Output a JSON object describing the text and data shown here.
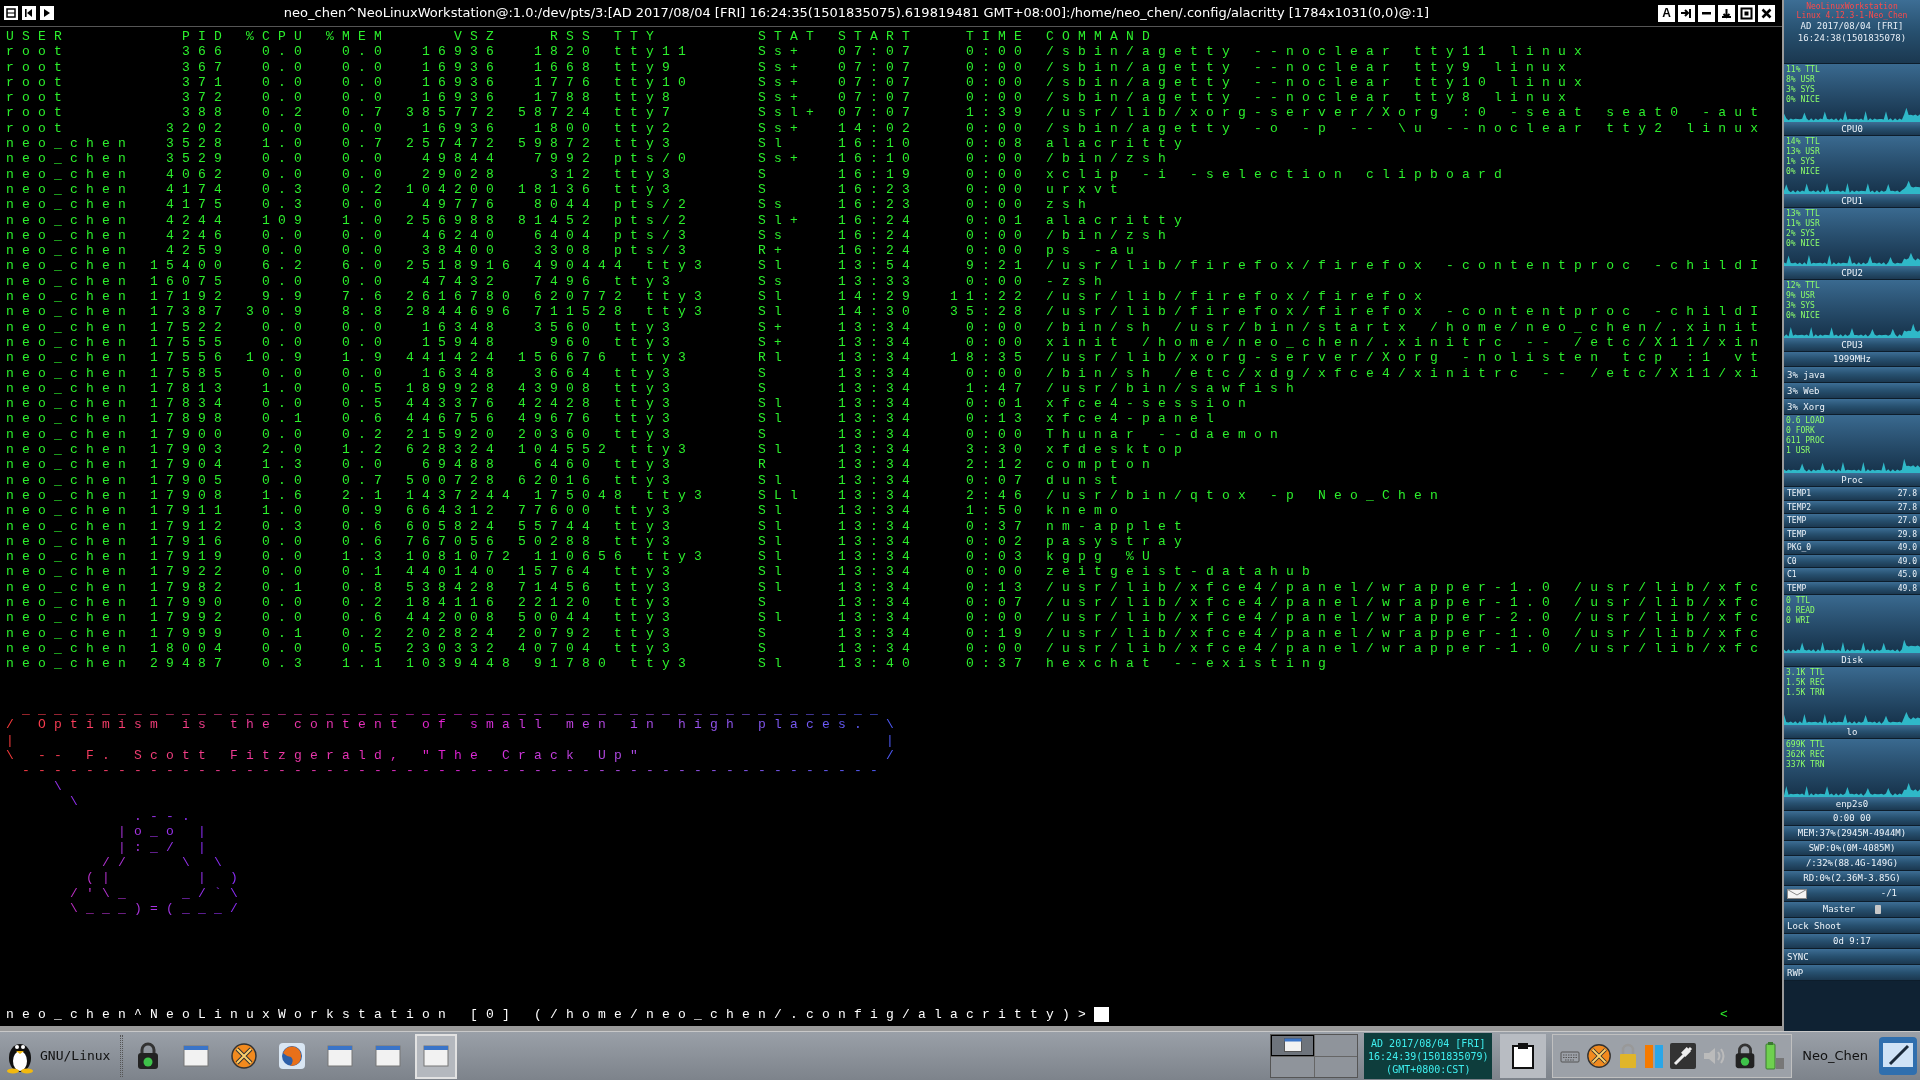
{
  "terminal": {
    "title": "neo_chen^NeoLinuxWorkstation@:1.0:/dev/pts/3:[AD 2017/08/04 [FRI] 16:24:35(1501835075).619819481 GMT+08:00]:/home/neo_chen/.config/alacritty [1784x1031(0,0)@:1]",
    "left_buttons": [
      {
        "kind": "menu"
      },
      {
        "kind": "prev"
      },
      {
        "kind": "next"
      }
    ],
    "right_buttons": [
      {
        "kind": "letter",
        "label": "A"
      },
      {
        "kind": "pin"
      },
      {
        "kind": "minimize"
      },
      {
        "kind": "shade"
      },
      {
        "kind": "maximize"
      },
      {
        "kind": "close"
      }
    ],
    "output": [
      "USER       PID %CPU %MEM    VSZ   RSS TTY      STAT START   TIME COMMAND",
      "root       366  0.0  0.0  16936  1820 tty11    Ss+  07:07   0:00 /sbin/agetty --noclear tty11 linux",
      "root       367  0.0  0.0  16936  1668 tty9     Ss+  07:07   0:00 /sbin/agetty --noclear tty9 linux",
      "root       371  0.0  0.0  16936  1776 tty10    Ss+  07:07   0:00 /sbin/agetty --noclear tty10 linux",
      "root       372  0.0  0.0  16936  1788 tty8     Ss+  07:07   0:00 /sbin/agetty --noclear tty8 linux",
      "root       388  0.2  0.7 385772 58724 tty7     Ssl+ 07:07   1:39 /usr/lib/xorg-server/Xorg :0 -seat seat0 -aut",
      "root      3202  0.0  0.0  16936  1800 tty2     Ss+  14:02   0:00 /sbin/agetty -o -p -- \\u --noclear tty2 linux",
      "neo_chen  3528  1.0  0.7 257472 59872 tty3     Sl   16:10   0:08 alacritty",
      "neo_chen  3529  0.0  0.0  49844  7992 pts/0    Ss+  16:10   0:00 /bin/zsh",
      "neo_chen  4062  0.0  0.0  29028   312 tty3     S    16:19   0:00 xclip -i -selection clipboard",
      "neo_chen  4174  0.3  0.2 104200 18136 tty3     S    16:23   0:00 urxvt",
      "neo_chen  4175  0.3  0.0  49776  8044 pts/2    Ss   16:23   0:00 zsh",
      "neo_chen  4244  109  1.0 256988 81452 pts/2    Sl+  16:24   0:01 alacritty",
      "neo_chen  4246  0.0  0.0  46240  6404 pts/3    Ss   16:24   0:00 /bin/zsh",
      "neo_chen  4259  0.0  0.0  38400  3308 pts/3    R+   16:24   0:00 ps -au",
      "neo_chen 15400  6.2  6.0 2518916 490444 tty3   Sl   13:54   9:21 /usr/lib/firefox/firefox -contentproc -childI",
      "neo_chen 16075  0.0  0.0  47432  7496 tty3     Ss   13:33   0:00 -zsh",
      "neo_chen 17192  9.9  7.6 2616780 620772 tty3   Sl   14:29  11:22 /usr/lib/firefox/firefox",
      "neo_chen 17387 30.9  8.8 2844696 711528 tty3   Sl   14:30  35:28 /usr/lib/firefox/firefox -contentproc -childI",
      "neo_chen 17522  0.0  0.0  16348  3560 tty3     S+   13:34   0:00 /bin/sh /usr/bin/startx /home/neo_chen/.xinit",
      "neo_chen 17555  0.0  0.0  15948   960 tty3     S+   13:34   0:00 xinit /home/neo_chen/.xinitrc -- /etc/X11/xin",
      "neo_chen 17556 10.9  1.9 441424 156676 tty3    Rl   13:34  18:35 /usr/lib/xorg-server/Xorg -nolisten tcp :1 vt",
      "neo_chen 17585  0.0  0.0  16348  3664 tty3     S    13:34   0:00 /bin/sh /etc/xdg/xfce4/xinitrc -- /etc/X11/xi",
      "neo_chen 17813  1.0  0.5 189928 43908 tty3     S    13:34   1:47 /usr/bin/sawfish",
      "neo_chen 17834  0.0  0.5 443376 42428 tty3     Sl   13:34   0:01 xfce4-session",
      "neo_chen 17898  0.1  0.6 446756 49676 tty3     Sl   13:34   0:13 xfce4-panel",
      "neo_chen 17900  0.0  0.2 215920 20360 tty3     S    13:34   0:00 Thunar --daemon",
      "neo_chen 17903  2.0  1.2 628324 104552 tty3    Sl   13:34   3:30 xfdesktop",
      "neo_chen 17904  1.3  0.0  69488  6460 tty3     R    13:34   2:12 compton",
      "neo_chen 17905  0.0  0.7 500728 62016 tty3     Sl   13:34   0:07 dunst",
      "neo_chen 17908  1.6  2.1 1437244 175048 tty3   SLl  13:34   2:46 /usr/bin/qtox -p Neo_Chen",
      "neo_chen 17911  1.0  0.9 664312 77600 tty3     Sl   13:34   1:50 knemo",
      "neo_chen 17912  0.3  0.6 605824 55744 tty3     Sl   13:34   0:37 nm-applet",
      "neo_chen 17916  0.0  0.6 767056 50288 tty3     Sl   13:34   0:02 pasystray",
      "neo_chen 17919  0.0  1.3 1081072 110656 tty3   Sl   13:34   0:03 kgpg %U",
      "neo_chen 17922  0.0  0.1 440140 15764 tty3     Sl   13:34   0:00 zeitgeist-datahub",
      "neo_chen 17982  0.1  0.8 538428 71456 tty3     Sl   13:34   0:13 /usr/lib/xfce4/panel/wrapper-1.0 /usr/lib/xfc",
      "neo_chen 17990  0.0  0.2 184116 22120 tty3     S    13:34   0:07 /usr/lib/xfce4/panel/wrapper-1.0 /usr/lib/xfc",
      "neo_chen 17992  0.0  0.6 442008 50044 tty3     Sl   13:34   0:00 /usr/lib/xfce4/panel/wrapper-2.0 /usr/lib/xfc",
      "neo_chen 17999  0.1  0.2 202824 20792 tty3     S    13:34   0:19 /usr/lib/xfce4/panel/wrapper-1.0 /usr/lib/xfc",
      "neo_chen 18004  0.0  0.5 230332 40704 tty3     S    13:34   0:00 /usr/lib/xfce4/panel/wrapper-1.0 /usr/lib/xfc",
      "neo_chen 29487  0.3  1.1 1039448 91780 tty3    Sl   13:40   0:37 hexchat --existing"
    ],
    "quote": [
      " ______________________________________________________",
      "/ Optimism is the content of small men in high places. \\",
      "|                                                      |",
      "\\ -- F. Scott Fitzgerald, \"The Crack Up\"               /",
      " ------------------------------------------------------",
      "   \\",
      "    \\",
      "        .--.",
      "       |o_o |",
      "       |:_/ |",
      "      //   \\ \\",
      "     (|     | )",
      "    /'\\_   _/`\\",
      "    \\___)=(___/"
    ],
    "prompt": "neo_chen^NeoLinuxWorkstation [0] (/home/neo_chen/.config/alacritty)>",
    "right_marker": "<"
  },
  "monitor": {
    "header": [
      "NeoLinuxWorkstation",
      "Linux 4.12.3-1-Neo_Chen"
    ],
    "clock": [
      "AD 2017/08/04 [FRI]",
      "16:24:38(1501835078)"
    ],
    "sections": [
      {
        "kind": "graph",
        "lines": [
          "11% TTL",
          "8% USR",
          "3% SYS",
          "0% NICE"
        ],
        "label": "CPU0"
      },
      {
        "kind": "graph",
        "lines": [
          "14% TTL",
          "13% USR",
          "1% SYS",
          "0% NICE"
        ],
        "label": "CPU1"
      },
      {
        "kind": "graph",
        "lines": [
          "13% TTL",
          "11% USR",
          "2% SYS",
          "0% NICE"
        ],
        "label": "CPU2"
      },
      {
        "kind": "graph",
        "lines": [
          "12% TTL",
          "9% USR",
          "3% SYS",
          "0% NICE"
        ],
        "label": "CPU3"
      },
      {
        "kind": "row",
        "text": "1999MHz"
      },
      {
        "kind": "proc",
        "text": "3% java"
      },
      {
        "kind": "proc",
        "text": "3% Web"
      },
      {
        "kind": "proc",
        "text": "3% Xorg"
      },
      {
        "kind": "graph",
        "lines": [
          "0.6 LOAD",
          "0 FORK",
          "611 PROC",
          "1 USR"
        ],
        "label": "Proc"
      },
      {
        "kind": "sensor",
        "name": "TEMP1",
        "value": "27.8"
      },
      {
        "kind": "sensor",
        "name": "TEMP2",
        "value": "27.8"
      },
      {
        "kind": "sensor",
        "name": "TEMP",
        "value": "27.0"
      },
      {
        "kind": "sensor",
        "name": "TEMP",
        "value": "29.8"
      },
      {
        "kind": "sensor",
        "name": "PKG_0",
        "value": "49.0"
      },
      {
        "kind": "sensor",
        "name": "C0",
        "value": "49.0"
      },
      {
        "kind": "sensor",
        "name": "C1",
        "value": "45.0"
      },
      {
        "kind": "sensor",
        "name": "TEMP",
        "value": "49.8"
      },
      {
        "kind": "graph",
        "lines": [
          "0 TTL",
          "0 READ",
          "0 WRI"
        ],
        "label": "Disk"
      },
      {
        "kind": "graph",
        "lines": [
          "3.1K TTL",
          "1.5K REC",
          "1.5K TRN"
        ],
        "label": "lo"
      },
      {
        "kind": "graph",
        "lines": [
          "699K TTL",
          "362K REC",
          "337K TRN"
        ],
        "label": "enp2s0"
      },
      {
        "kind": "row",
        "text": "0:00 00"
      },
      {
        "kind": "row",
        "text": "MEM:37%(2945M-4944M)"
      },
      {
        "kind": "row",
        "text": "SWP:0%(0M-4085M)"
      },
      {
        "kind": "row",
        "text": "/:32%(88.4G-149G)"
      },
      {
        "kind": "row",
        "text": "RD:0%(2.36M-3.85G)"
      },
      {
        "kind": "mail",
        "text": "-/1"
      },
      {
        "kind": "volume",
        "text": "Master"
      },
      {
        "kind": "proc",
        "text": "Lock Shoot"
      },
      {
        "kind": "row",
        "text": "0d 9:17"
      },
      {
        "kind": "proc",
        "text": "SYNC"
      },
      {
        "kind": "proc",
        "text": "RWP"
      }
    ]
  },
  "taskbar": {
    "menu_label": "GNU/Linux",
    "tasks": [
      {
        "kind": "lock",
        "selected": false
      },
      {
        "kind": "window",
        "selected": false
      },
      {
        "kind": "cross",
        "selected": false
      },
      {
        "kind": "browser",
        "selected": false
      },
      {
        "kind": "window",
        "selected": false
      },
      {
        "kind": "window",
        "selected": false
      },
      {
        "kind": "window",
        "selected": true
      }
    ],
    "workspaces": [
      {
        "selected": true
      },
      {
        "selected": false
      },
      {
        "selected": false
      },
      {
        "selected": false
      }
    ],
    "clock": [
      "AD 2017/08/04 [FRI]",
      "16:24:39(1501835079)",
      "(GMT+0800:CST)"
    ],
    "tray": [
      {
        "kind": "keyboard"
      },
      {
        "kind": "cross"
      },
      {
        "kind": "padlock"
      },
      {
        "kind": "bars"
      },
      {
        "kind": "plug"
      },
      {
        "kind": "speaker"
      },
      {
        "kind": "lock"
      },
      {
        "kind": "battery"
      }
    ],
    "user": "Neo_Chen"
  }
}
